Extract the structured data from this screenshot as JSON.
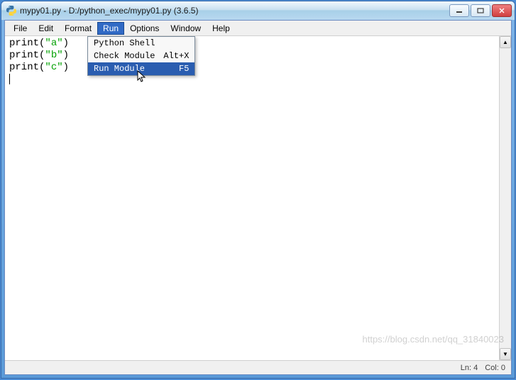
{
  "window": {
    "title": "mypy01.py - D:/python_exec/mypy01.py (3.6.5)"
  },
  "menubar": {
    "items": [
      {
        "label": "File"
      },
      {
        "label": "Edit"
      },
      {
        "label": "Format"
      },
      {
        "label": "Run"
      },
      {
        "label": "Options"
      },
      {
        "label": "Window"
      },
      {
        "label": "Help"
      }
    ],
    "active_index": 3
  },
  "dropdown": {
    "items": [
      {
        "label": "Python Shell",
        "shortcut": ""
      },
      {
        "label": "Check Module",
        "shortcut": "Alt+X"
      },
      {
        "label": "Run Module",
        "shortcut": "F5"
      }
    ],
    "highlight_index": 2
  },
  "editor": {
    "lines": [
      {
        "fn": "print",
        "open": "(",
        "str": "\"a\"",
        "close": ")"
      },
      {
        "fn": "print",
        "open": "(",
        "str": "\"b\"",
        "close": ")"
      },
      {
        "fn": "print",
        "open": "(",
        "str": "\"c\"",
        "close": ")"
      }
    ]
  },
  "status": {
    "line": "Ln: 4",
    "col": "Col: 0"
  },
  "watermark": "https://blog.csdn.net/qq_31840023"
}
